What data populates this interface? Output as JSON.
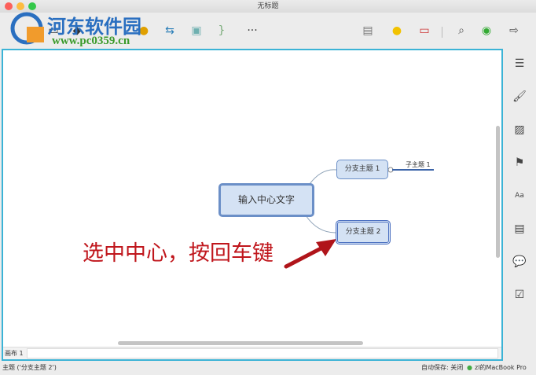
{
  "window": {
    "title": "无标题"
  },
  "watermark": {
    "name": "河东软件园",
    "url": "www.pc0359.cn"
  },
  "toolbar": {
    "more": "···"
  },
  "map": {
    "central": "输入中心文字",
    "branch1": "分支主题 1",
    "branch2": "分支主题 2",
    "sub1": "子主题 1"
  },
  "annotation": "选中中心，按回车键",
  "sheet": {
    "tab": "画布 1"
  },
  "status": {
    "selection": "主题 ('分支主题 2')",
    "autosave": "自动保存: 关闭",
    "device": "zl的MacBook Pro"
  },
  "colors": {
    "accent": "#3bb3d6",
    "node_border": "#6b8fc7",
    "node_fill": "#d4e2f4",
    "annotation": "#c0161c"
  }
}
